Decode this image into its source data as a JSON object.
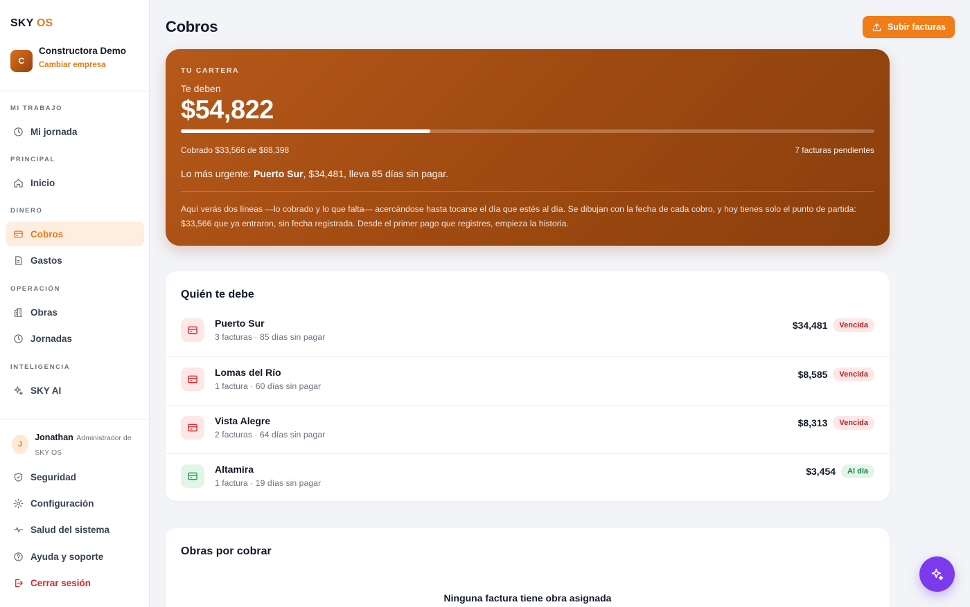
{
  "brand": {
    "name": "SKY",
    "suffix": "OS"
  },
  "company": {
    "initial": "C",
    "name": "Constructora Demo",
    "switch_label": "Cambiar empresa"
  },
  "sidebar": {
    "sections": [
      {
        "label": "MI TRABAJO",
        "items": [
          {
            "label": "Mi jornada",
            "icon": "clock-icon"
          }
        ]
      },
      {
        "label": "PRINCIPAL",
        "items": [
          {
            "label": "Inicio",
            "icon": "home-icon"
          }
        ]
      },
      {
        "label": "DINERO",
        "items": [
          {
            "label": "Cobros",
            "icon": "card-icon",
            "active": true
          },
          {
            "label": "Gastos",
            "icon": "document-icon"
          }
        ]
      },
      {
        "label": "OPERACIÓN",
        "items": [
          {
            "label": "Obras",
            "icon": "building-icon"
          },
          {
            "label": "Jornadas",
            "icon": "clock-icon"
          }
        ]
      },
      {
        "label": "INTELIGENCIA",
        "items": [
          {
            "label": "SKY AI",
            "icon": "sparkle-icon"
          }
        ]
      }
    ]
  },
  "user": {
    "initial": "J",
    "name": "Jonathan",
    "role": "Administrador de SKY OS"
  },
  "bottom_nav": [
    {
      "label": "Seguridad",
      "icon": "shield-icon"
    },
    {
      "label": "Configuración",
      "icon": "gear-icon"
    },
    {
      "label": "Salud del sistema",
      "icon": "pulse-icon"
    },
    {
      "label": "Ayuda y soporte",
      "icon": "help-icon"
    },
    {
      "label": "Cerrar sesión",
      "icon": "logout-icon"
    }
  ],
  "page": {
    "title": "Cobros",
    "upload_label": "Subir facturas"
  },
  "hero": {
    "label": "TU CARTERA",
    "subtitle": "Te deben",
    "amount": "$54,822",
    "progress": 0.36,
    "collected": "Cobrado $33,566 de $88,398",
    "pending": "7 facturas pendientes",
    "urgent_prefix": "Lo más urgente: ",
    "urgent_name": "Puerto Sur",
    "urgent_suffix": ", $34,481, lleva 85 días sin pagar.",
    "note": "Aquí verás dos líneas —lo cobrado y lo que falta— acercándose hasta tocarse el día que estés al día. Se dibujan con la fecha de cada cobro, y hoy tienes solo el punto de partida: $33,566 que ya entraron, sin fecha registrada. Desde el primer pago que registres, empieza la historia."
  },
  "debtors": {
    "title": "Quién te debe",
    "rows": [
      {
        "name": "Puerto Sur",
        "meta": "3 facturas · 85 días sin pagar",
        "amount": "$34,481",
        "status": "Vencida"
      },
      {
        "name": "Lomas del Río",
        "meta": "1 factura · 60 días sin pagar",
        "amount": "$8,585",
        "status": "Vencida"
      },
      {
        "name": "Vista Alegre",
        "meta": "2 facturas · 64 días sin pagar",
        "amount": "$8,313",
        "status": "Vencida"
      },
      {
        "name": "Altamira",
        "meta": "1 factura · 19 días sin pagar",
        "amount": "$3,454",
        "status": "Al día"
      }
    ]
  },
  "works": {
    "title": "Obras por cobrar",
    "empty": "Ninguna factura tiene obra asignada"
  },
  "colors": {
    "accent": "#ea7a17",
    "danger": "#dc2626",
    "success": "#16a34a",
    "ai": "#7c3aed"
  }
}
